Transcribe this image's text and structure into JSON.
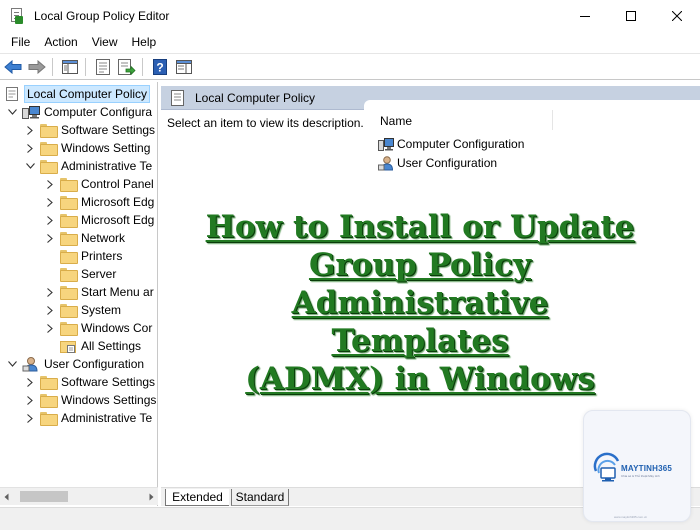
{
  "window": {
    "title": "Local Group Policy Editor"
  },
  "menu": [
    "File",
    "Action",
    "View",
    "Help"
  ],
  "tree": {
    "root": "Local Computer Policy",
    "items": [
      "Computer Configura",
      "Software Settings",
      "Windows Setting",
      "Administrative Te",
      "Control Panel",
      "Microsoft Edg",
      "Microsoft Edg",
      "Network",
      "Printers",
      "Server",
      "Start Menu ar",
      "System",
      "Windows Cor",
      "All Settings",
      "User Configuration",
      "Software Settings",
      "Windows Settings",
      "Administrative Te"
    ]
  },
  "details": {
    "header": "Local Computer Policy",
    "description": "Select an item to view its description.",
    "column_name": "Name",
    "rows": [
      "Computer Configuration",
      "User Configuration"
    ]
  },
  "tabs": {
    "extended": "Extended",
    "standard": "Standard"
  },
  "overlay": {
    "line1": "How to Install or Update",
    "line2": "Group Policy",
    "line3": "Administrative Templates",
    "line4": "(ADMX) in Windows"
  },
  "watermark": {
    "brand": "MAYTINH365",
    "tagline": "Chia sẻ & Thủ thuật Máy tính",
    "url": "www.maytinh365.com.vn"
  },
  "colors": {
    "header_band": "#c6d1e1",
    "selection": "#cce8ff",
    "overlay_text": "#227a22"
  },
  "icons": {
    "app": "group-policy-icon",
    "folder": "folder-icon",
    "computer": "computer-icon",
    "user": "user-icon",
    "policy": "policy-document-icon"
  }
}
